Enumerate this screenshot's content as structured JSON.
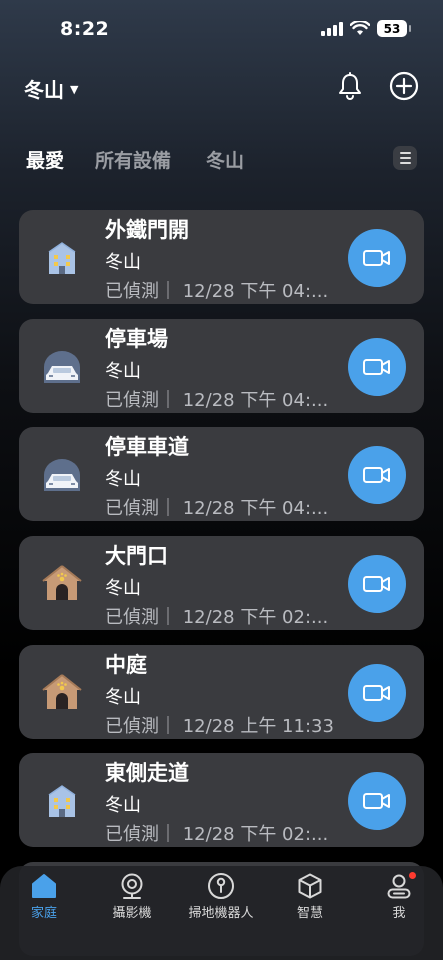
{
  "status_bar": {
    "time": "8:22",
    "battery": "53"
  },
  "header": {
    "home_name": "冬山"
  },
  "tabs": [
    {
      "label": "最愛",
      "active": true
    },
    {
      "label": "所有設備",
      "active": false
    },
    {
      "label": "冬山",
      "active": false
    }
  ],
  "devices": [
    {
      "title": "外鐵門開",
      "home": "冬山",
      "status": "已偵測｜ 12/28 下午 04:...",
      "icon": "building-icon"
    },
    {
      "title": "停車場",
      "home": "冬山",
      "status": "已偵測｜ 12/28 下午 04:...",
      "icon": "car-garage-icon"
    },
    {
      "title": "停車車道",
      "home": "冬山",
      "status": "已偵測｜ 12/28 下午 04:...",
      "icon": "car-garage-icon"
    },
    {
      "title": "大門口",
      "home": "冬山",
      "status": "已偵測｜ 12/28 下午 02:...",
      "icon": "doghouse-icon"
    },
    {
      "title": "中庭",
      "home": "冬山",
      "status": "已偵測｜ 12/28 上午 11:33",
      "icon": "doghouse-icon"
    },
    {
      "title": "東側走道",
      "home": "冬山",
      "status": "已偵測｜ 12/28 下午 02:...",
      "icon": "building-icon"
    }
  ],
  "tab_bar": [
    {
      "label": "家庭",
      "icon": "home-icon",
      "active": true
    },
    {
      "label": "攝影機",
      "icon": "webcam-icon",
      "active": false
    },
    {
      "label": "掃地機器人",
      "icon": "robot-vacuum-icon",
      "active": false
    },
    {
      "label": "智慧",
      "icon": "cube-icon",
      "active": false
    },
    {
      "label": "我",
      "icon": "person-icon",
      "active": false
    }
  ],
  "colors": {
    "accent": "#4aa1ea",
    "card": "#3a3b3f",
    "notification_dot": "#ff3b30"
  }
}
